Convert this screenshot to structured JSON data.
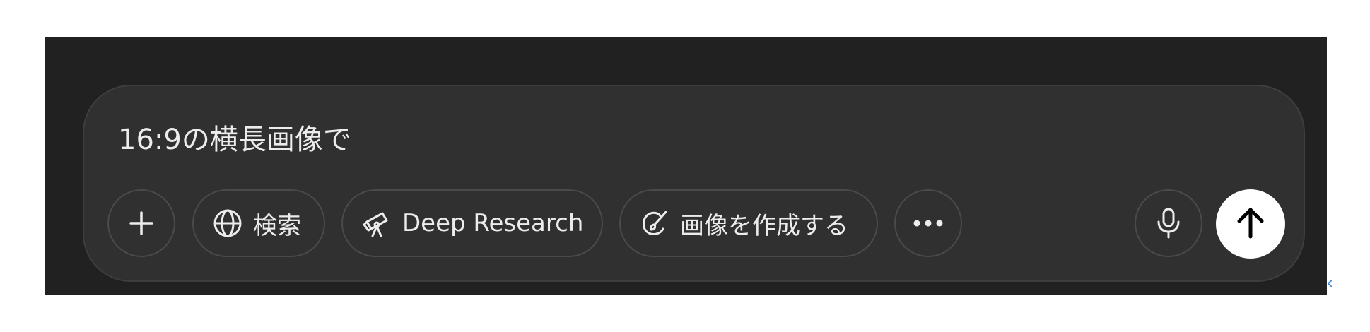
{
  "composer": {
    "prompt_text": "16:9の横長画像で"
  },
  "toolbar": {
    "add_icon": "plus-icon",
    "search": {
      "icon": "globe-icon",
      "label": "検索"
    },
    "deep_research": {
      "icon": "telescope-icon",
      "label": "Deep Research"
    },
    "create_image": {
      "icon": "image-brush-icon",
      "label": "画像を作成する"
    },
    "more_icon": "ellipsis-icon",
    "mic_icon": "microphone-icon",
    "send_icon": "arrow-up-icon"
  },
  "colors": {
    "panel_bg": "#212121",
    "composer_bg": "#303030",
    "text": "#ececec",
    "send_bg": "#ffffff"
  }
}
